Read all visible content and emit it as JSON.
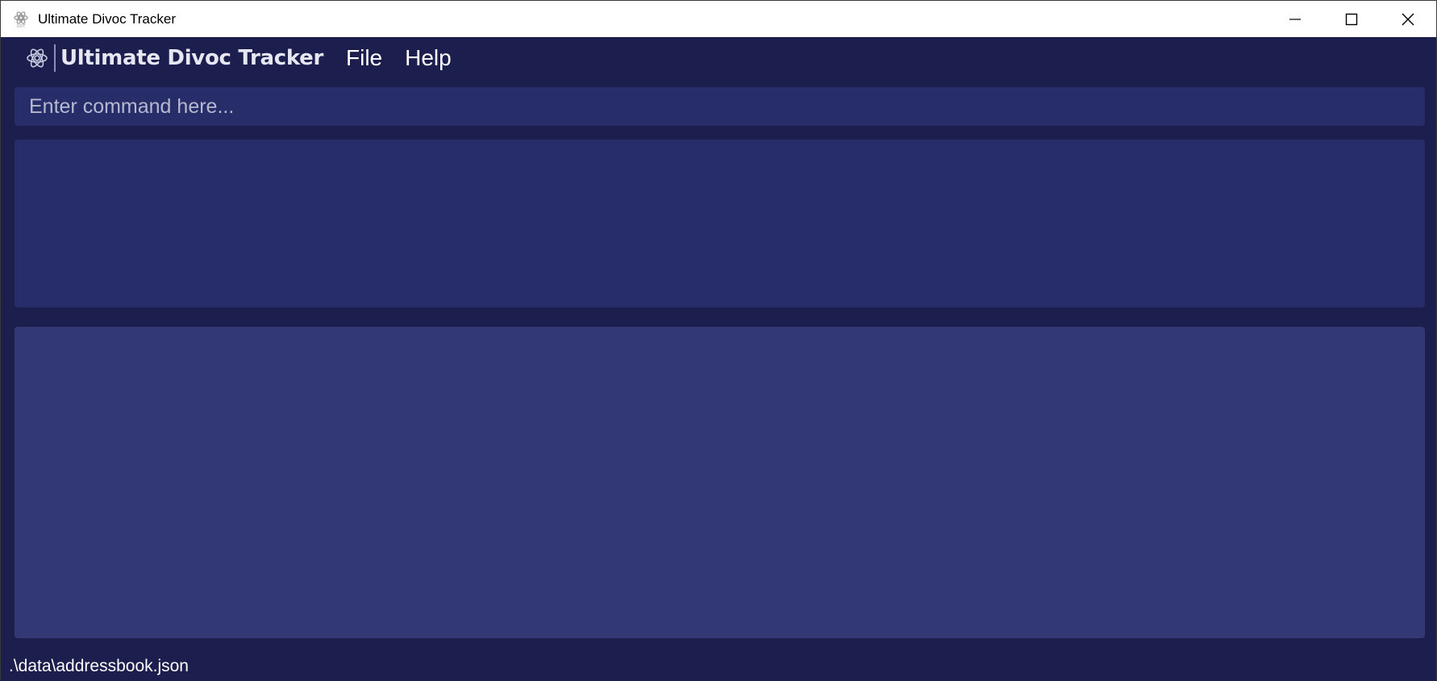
{
  "window": {
    "title": "Ultimate Divoc Tracker",
    "app_icon": "atom-icon",
    "controls": [
      "minimize-icon",
      "maximize-icon",
      "close-icon"
    ]
  },
  "menubar": {
    "brand_name": "Ultimate Divoc Tracker",
    "logo_icon": "atom-icon",
    "items": [
      {
        "label": "File"
      },
      {
        "label": "Help"
      }
    ]
  },
  "command": {
    "placeholder": "Enter command here...",
    "value": ""
  },
  "result_display": {
    "text": ""
  },
  "status": {
    "file_path": ".\\data\\addressbook.json"
  },
  "colors": {
    "background": "#1c1f4d",
    "panel": "#262d68",
    "list_panel": "#313873",
    "titlebar": "#ffffff"
  }
}
